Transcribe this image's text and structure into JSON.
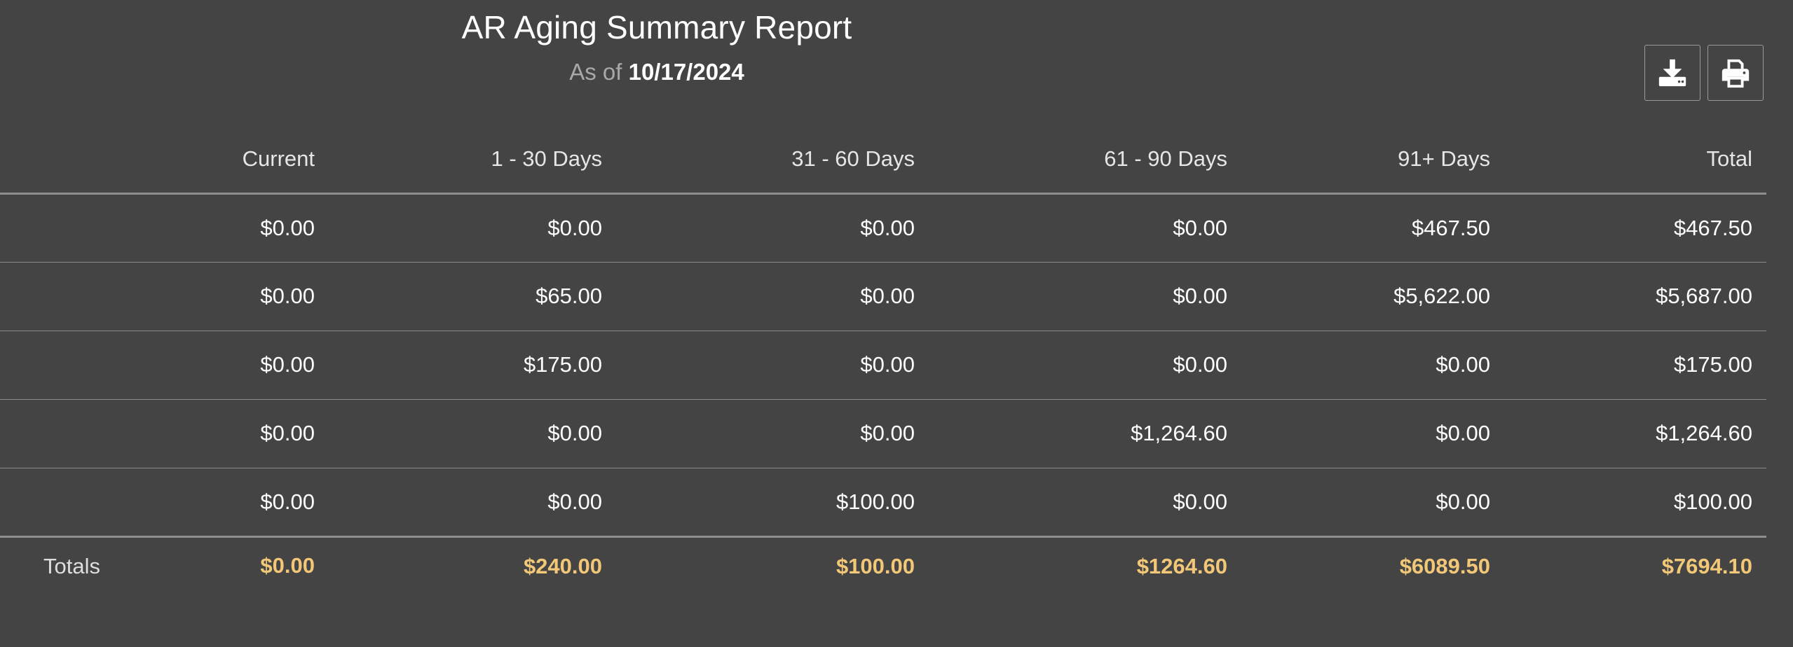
{
  "report": {
    "title": "AR Aging Summary Report",
    "as_of_label": "As of",
    "as_of_date": "10/17/2024"
  },
  "toolbar": {
    "download_icon": "download-icon",
    "print_icon": "printer-icon"
  },
  "table": {
    "headers": [
      "Current",
      "1 - 30 Days",
      "31 - 60 Days",
      "61 - 90 Days",
      "91+ Days",
      "Total"
    ],
    "rows": [
      [
        "$0.00",
        "$0.00",
        "$0.00",
        "$0.00",
        "$467.50",
        "$467.50"
      ],
      [
        "$0.00",
        "$65.00",
        "$0.00",
        "$0.00",
        "$5,622.00",
        "$5,687.00"
      ],
      [
        "$0.00",
        "$175.00",
        "$0.00",
        "$0.00",
        "$0.00",
        "$175.00"
      ],
      [
        "$0.00",
        "$0.00",
        "$0.00",
        "$1,264.60",
        "$0.00",
        "$1,264.60"
      ],
      [
        "$0.00",
        "$0.00",
        "$100.00",
        "$0.00",
        "$0.00",
        "$100.00"
      ]
    ],
    "totals_label": "Totals",
    "totals": [
      "$0.00",
      "$240.00",
      "$100.00",
      "$1264.60",
      "$6089.50",
      "$7694.10"
    ]
  },
  "colors": {
    "background": "#444444",
    "totals_accent": "#f2c878"
  }
}
